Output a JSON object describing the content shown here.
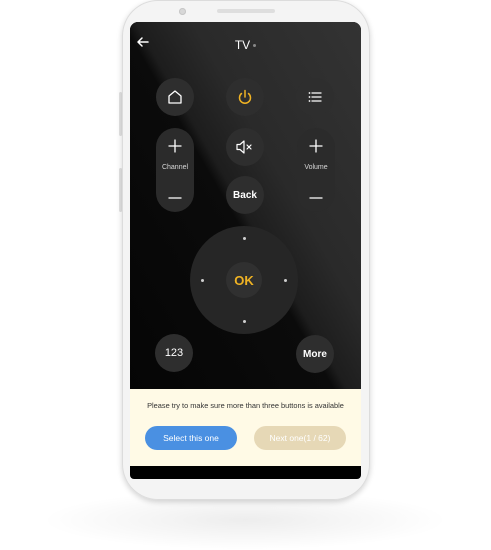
{
  "header": {
    "title": "TV",
    "back_icon": "arrow-left-icon"
  },
  "remote": {
    "home_icon": "home-icon",
    "power_icon": "power-icon",
    "menu_icon": "list-menu-icon",
    "mute_icon": "mute-icon",
    "channel_label": "Channel",
    "volume_label": "Volume",
    "back_label": "Back",
    "ok_label": "OK",
    "numbers_label": "123",
    "more_label": "More"
  },
  "banner": {
    "hint": "Please try to make sure more than three buttons is available",
    "select_label": "Select this one",
    "next_label": "Next one(1 / 62)"
  },
  "colors": {
    "accent_yellow": "#f0b323",
    "select_blue": "#4a90e2",
    "next_beige": "#e6d8b6",
    "banner_bg": "#fffae6"
  }
}
